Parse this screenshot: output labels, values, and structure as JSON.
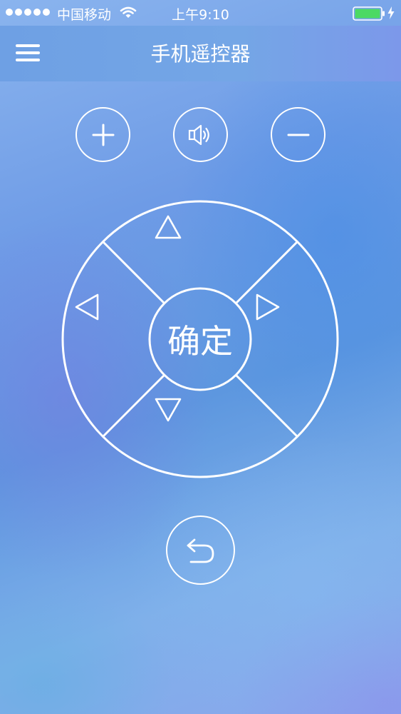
{
  "status_bar": {
    "carrier": "中国移动",
    "time": "上午9:10",
    "battery_color": "#4cd964"
  },
  "nav": {
    "title": "手机遥控器",
    "menu_icon": "hamburger-menu-icon"
  },
  "volume_controls": {
    "up_icon": "plus-icon",
    "mute_icon": "speaker-icon",
    "down_icon": "minus-icon"
  },
  "dpad": {
    "ok_label": "确定",
    "up_icon": "triangle-up-icon",
    "down_icon": "triangle-down-icon",
    "left_icon": "triangle-left-icon",
    "right_icon": "triangle-right-icon"
  },
  "back": {
    "icon": "back-arrow-icon"
  },
  "colors": {
    "foreground": "#ffffff",
    "background_blue": "#6e9be6"
  }
}
